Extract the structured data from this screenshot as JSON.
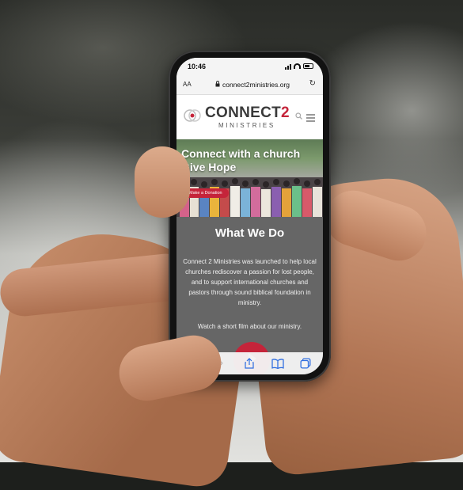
{
  "status_bar": {
    "time": "10:46"
  },
  "browser": {
    "text_size_label": "AA",
    "url": "connect2ministries.org",
    "reload_icon": "reload-icon",
    "toolbar_icons": [
      "back-icon",
      "forward-icon",
      "share-icon",
      "bookmarks-icon",
      "tabs-icon"
    ]
  },
  "site": {
    "brand": {
      "name": "CONNECT",
      "number": "2",
      "sub": "MINISTRIES"
    },
    "accent_color": "#c5243a",
    "hero": {
      "title": "Connect with a church Give Hope",
      "button": "Make a Donation"
    },
    "section": {
      "heading": "What We Do",
      "body": "Connect 2 Ministries was launched to help local churches rediscover a passion for lost people, and to support international churches and pastors through sound biblical foundation in ministry.",
      "watch": "Watch a short film about our ministry."
    }
  }
}
